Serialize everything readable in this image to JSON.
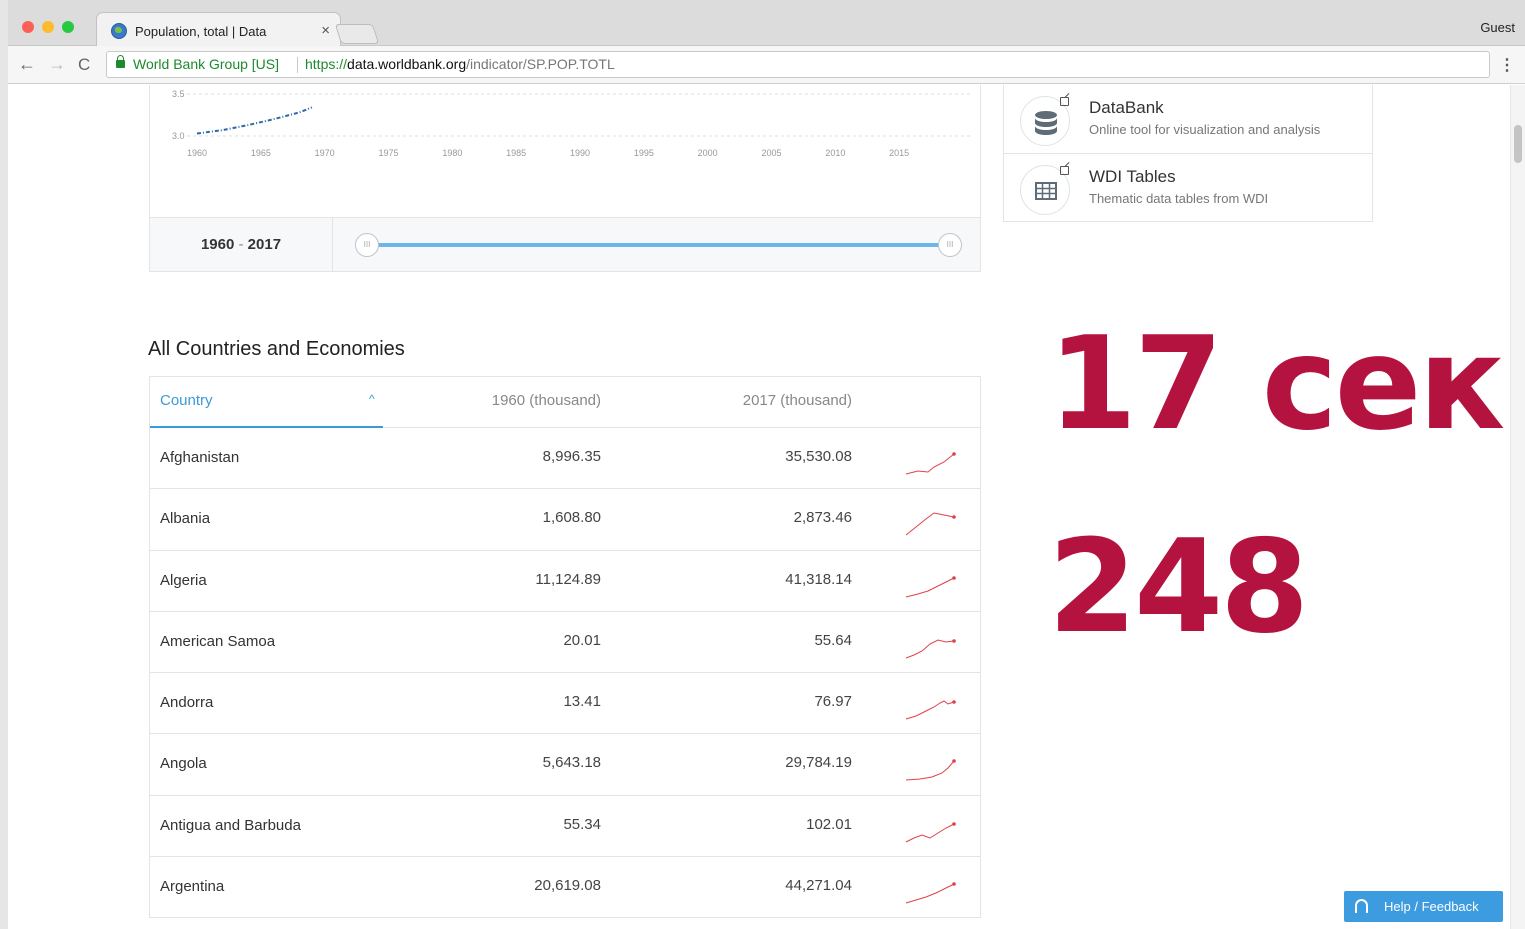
{
  "browser": {
    "tab_title": "Population, total | Data",
    "tab_close": "×",
    "profile": "Guest",
    "org": "World Bank Group [US]",
    "url_scheme": "https://",
    "url_host": "data.worldbank.org",
    "url_path": "/indicator/SP.POP.TOTL",
    "back": "←",
    "forward": "→",
    "reload": "C",
    "menu": "⋮"
  },
  "chart_data": {
    "type": "line",
    "x_ticks": [
      "1960",
      "1965",
      "1970",
      "1975",
      "1980",
      "1985",
      "1990",
      "1995",
      "2000",
      "2005",
      "2010",
      "2015"
    ],
    "y_ticks": [
      "3.5",
      "3.0"
    ],
    "series": [
      {
        "x": [
          1960,
          1962,
          1964,
          1966,
          1968,
          1969
        ],
        "y": [
          3.03,
          3.07,
          3.13,
          3.2,
          3.28,
          3.34
        ]
      }
    ],
    "color": "#2f68a8"
  },
  "range": {
    "start": "1960",
    "dash": "-",
    "end": "2017",
    "handle_left": "III",
    "handle_right": "III"
  },
  "sidebar": {
    "cards": [
      {
        "title": "DataBank",
        "subtitle": "Online tool for visualization and analysis",
        "icon": "database-icon"
      },
      {
        "title": "WDI Tables",
        "subtitle": "Thematic data tables from WDI",
        "icon": "table-icon"
      }
    ]
  },
  "section_title": "All Countries and Economies",
  "table": {
    "col_country": "Country",
    "col_1960": "1960 (thousand)",
    "col_2017": "2017 (thousand)",
    "sort_indicator": "^",
    "rows": [
      {
        "country": "Afghanistan",
        "v1960": "8,996.35",
        "v2017": "35,530.08"
      },
      {
        "country": "Albania",
        "v1960": "1,608.80",
        "v2017": "2,873.46"
      },
      {
        "country": "Algeria",
        "v1960": "11,124.89",
        "v2017": "41,318.14"
      },
      {
        "country": "American Samoa",
        "v1960": "20.01",
        "v2017": "55.64"
      },
      {
        "country": "Andorra",
        "v1960": "13.41",
        "v2017": "76.97"
      },
      {
        "country": "Angola",
        "v1960": "5,643.18",
        "v2017": "29,784.19"
      },
      {
        "country": "Antigua and Barbuda",
        "v1960": "55.34",
        "v2017": "102.01"
      },
      {
        "country": "Argentina",
        "v1960": "20,619.08",
        "v2017": "44,271.04"
      }
    ]
  },
  "overlay": {
    "line1": "17 сек.",
    "line2": "248"
  },
  "help": {
    "label": "Help / Feedback"
  },
  "colors": {
    "accent": "#3b9ad9",
    "overlay": "#b4123f",
    "sparkline": "#e0404a"
  }
}
